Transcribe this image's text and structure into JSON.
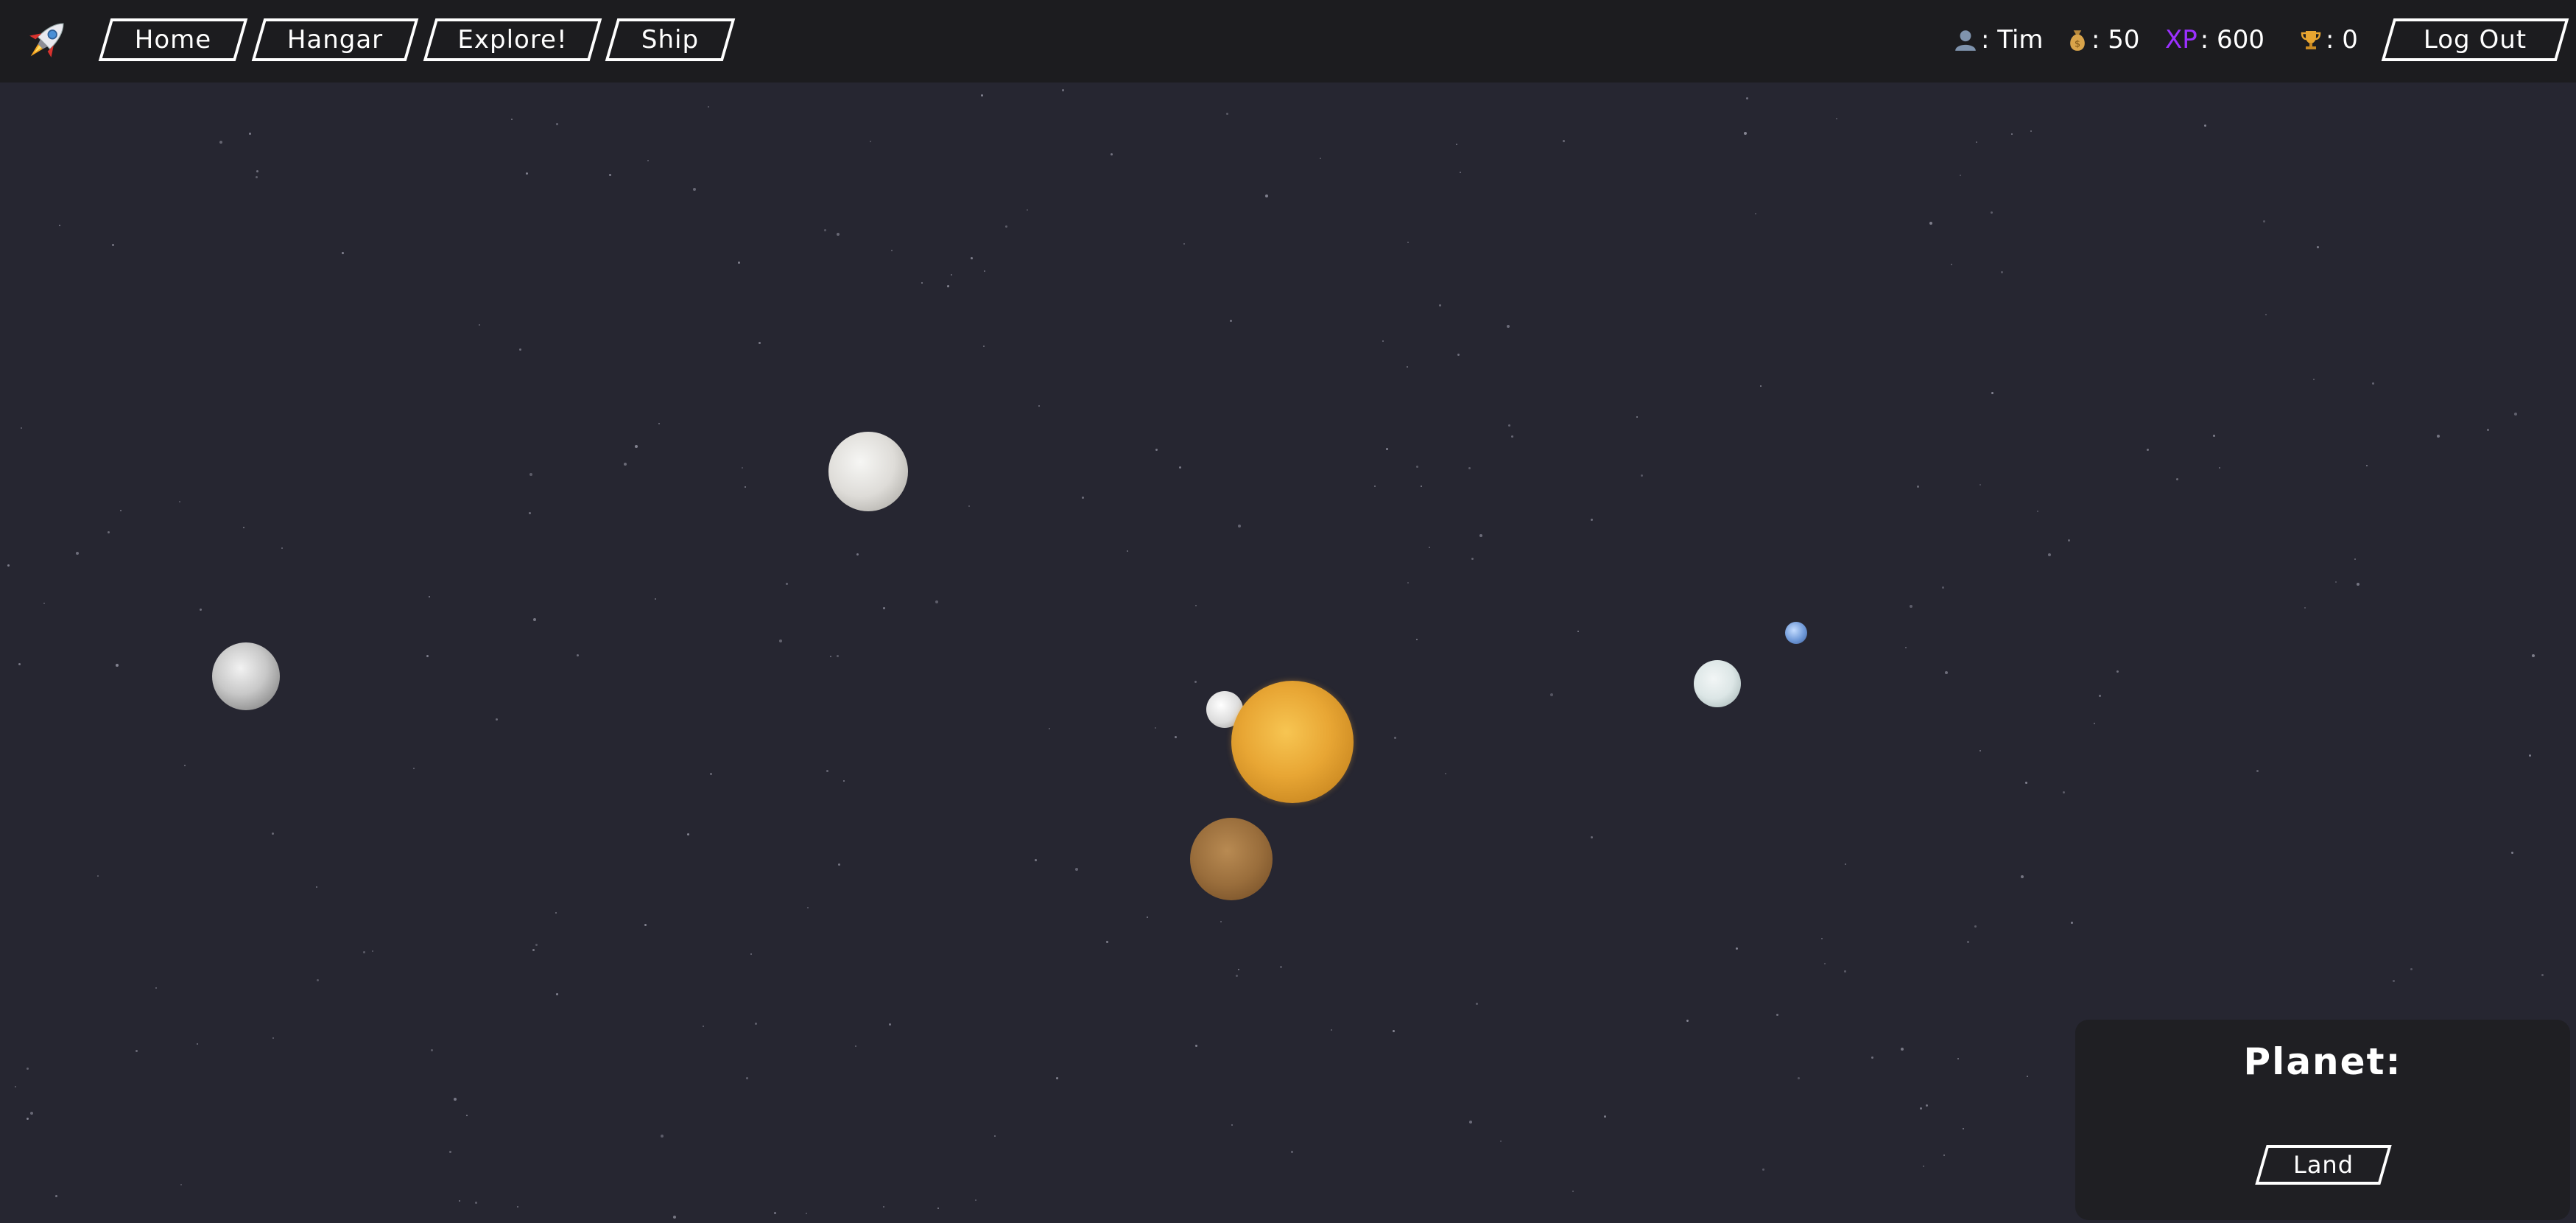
{
  "nav": {
    "logo_icon": "rocket-icon",
    "home_label": "Home",
    "hangar_label": "Hangar",
    "explore_label": "Explore!",
    "ship_label": "Ship"
  },
  "stats": {
    "user_icon": "user-icon",
    "user_label": ": Tim",
    "coins_icon": "money-bag-icon",
    "coins_label": ": 50",
    "xp_prefix": "XP",
    "xp_label": ": 600",
    "xp_color": "#9b30ff",
    "trophy_icon": "trophy-icon",
    "trophy_label": ": 0"
  },
  "account": {
    "logout_label": "Log Out"
  },
  "panel": {
    "title": "Planet:",
    "land_label": "Land"
  },
  "colors": {
    "background": "#262631",
    "topbar": "#1c1c1f",
    "panel": "#1f1f23"
  },
  "planets": [
    {
      "name": "planet-left",
      "color": "#c8c8c8"
    },
    {
      "name": "planet-upper",
      "color": "#dedcd8"
    },
    {
      "name": "moon-small",
      "color": "#dcdcdc"
    },
    {
      "name": "sun",
      "color": "#e8a634"
    },
    {
      "name": "planet-brown",
      "color": "#9a6e3c"
    },
    {
      "name": "planet-white",
      "color": "#dce6e6"
    },
    {
      "name": "planet-blue",
      "color": "#6f99d8"
    }
  ]
}
